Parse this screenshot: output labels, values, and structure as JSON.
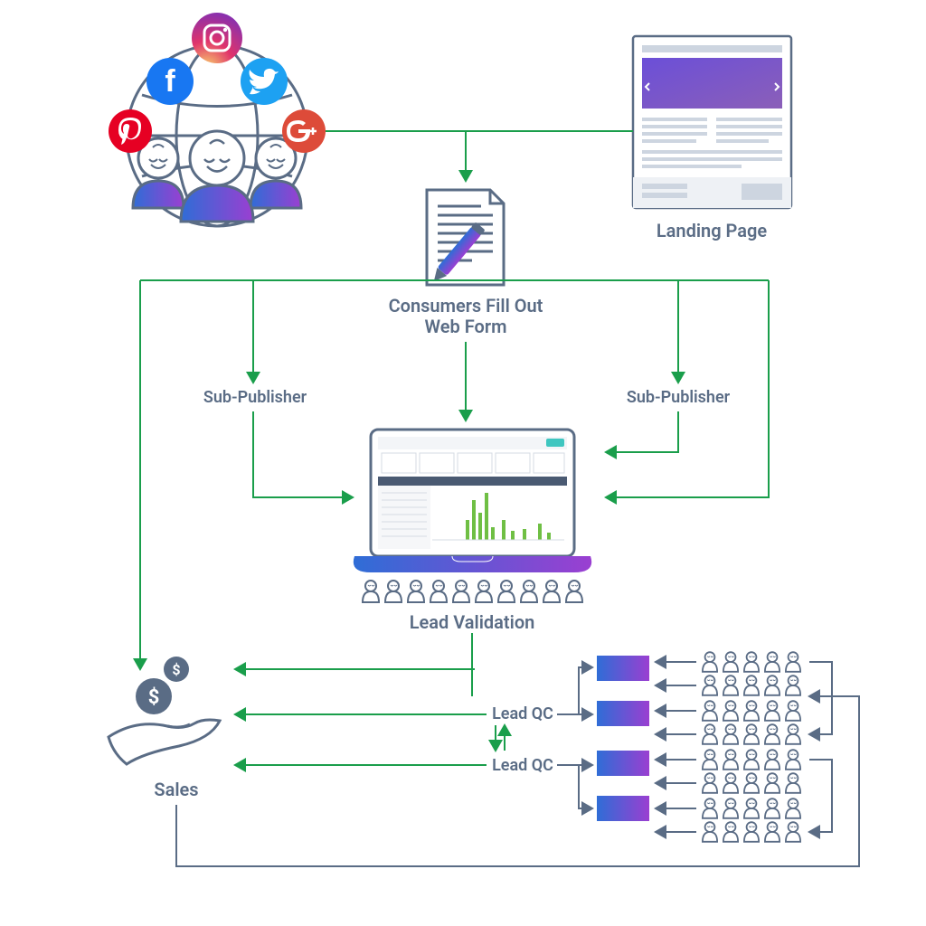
{
  "labels": {
    "landing_page": "Landing Page",
    "web_form_l1": "Consumers Fill Out",
    "web_form_l2": "Web Form",
    "sub_pub_left": "Sub-Publisher",
    "sub_pub_right": "Sub-Publisher",
    "lead_validation": "Lead Validation",
    "lead_qc_1": "Lead QC",
    "lead_qc_2": "Lead QC",
    "sales": "Sales"
  },
  "social": {
    "instagram": "instagram-icon",
    "facebook": "facebook-icon",
    "twitter": "twitter-icon",
    "pinterest": "pinterest-icon",
    "googleplus": "googleplus-icon"
  },
  "colors": {
    "arrow_green": "#1a9e4b",
    "arrow_blue": "#5a6c85",
    "text": "#5a6c85",
    "grad_start": "#2f6dd6",
    "grad_end": "#9a3fd1",
    "facebook": "#1877f2",
    "twitter": "#1da1f2",
    "pinterest": "#e60023",
    "googleplus": "#dd4b39",
    "ig_a": "#f9d36b",
    "ig_b": "#e0336b",
    "ig_c": "#7b2fb8"
  }
}
